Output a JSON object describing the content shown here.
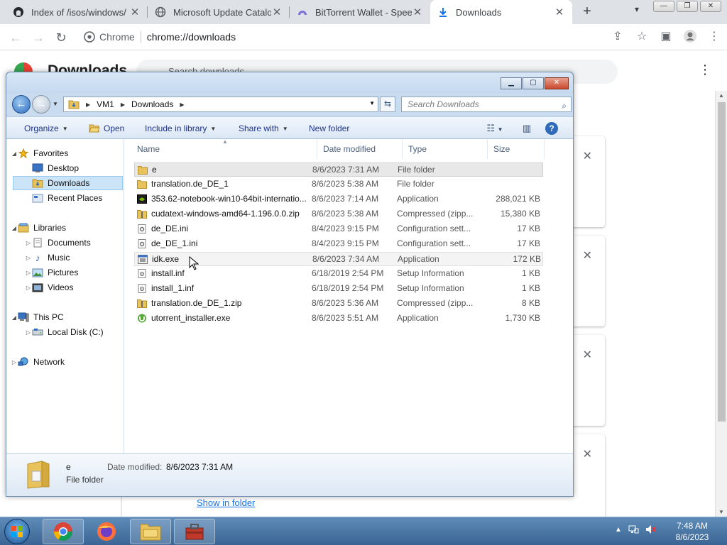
{
  "browser": {
    "tabs": [
      {
        "title": "Index of /isos/windows/",
        "icon": "github-icon"
      },
      {
        "title": "Microsoft Update Catalog",
        "icon": "globe-icon"
      },
      {
        "title": "BitTorrent Wallet - Speed",
        "icon": "bittorrent-icon"
      },
      {
        "title": "Downloads",
        "icon": "download-icon"
      }
    ],
    "omnibox": {
      "chip": "Chrome",
      "url": "chrome://downloads"
    },
    "page": {
      "title": "Downloads",
      "search_placeholder": "Search downloads",
      "show_in_folder": "Show in folder"
    }
  },
  "explorer": {
    "breadcrumb": [
      "VM1",
      "Downloads"
    ],
    "search_placeholder": "Search Downloads",
    "commands": {
      "organize": "Organize",
      "open": "Open",
      "include": "Include in library",
      "share": "Share with",
      "newfolder": "New folder"
    },
    "nav": {
      "favorites": "Favorites",
      "desktop": "Desktop",
      "downloads": "Downloads",
      "recent": "Recent Places",
      "libraries": "Libraries",
      "documents": "Documents",
      "music": "Music",
      "pictures": "Pictures",
      "videos": "Videos",
      "thispc": "This PC",
      "localdisk": "Local Disk (C:)",
      "network": "Network"
    },
    "columns": {
      "name": "Name",
      "date": "Date modified",
      "type": "Type",
      "size": "Size"
    },
    "files": [
      {
        "name": "e",
        "date": "8/6/2023 7:31 AM",
        "type": "File folder",
        "size": "",
        "icon": "folder-icon"
      },
      {
        "name": "translation.de_DE_1",
        "date": "8/6/2023 5:38 AM",
        "type": "File folder",
        "size": "",
        "icon": "folder-icon"
      },
      {
        "name": "353.62-notebook-win10-64bit-internatio...",
        "date": "8/6/2023 7:14 AM",
        "type": "Application",
        "size": "288,021 KB",
        "icon": "nvidia-icon"
      },
      {
        "name": "cudatext-windows-amd64-1.196.0.0.zip",
        "date": "8/6/2023 5:38 AM",
        "type": "Compressed (zipp...",
        "size": "15,380 KB",
        "icon": "zip-folder-icon"
      },
      {
        "name": "de_DE.ini",
        "date": "8/4/2023 9:15 PM",
        "type": "Configuration sett...",
        "size": "17 KB",
        "icon": "config-file-icon"
      },
      {
        "name": "de_DE_1.ini",
        "date": "8/4/2023 9:15 PM",
        "type": "Configuration sett...",
        "size": "17 KB",
        "icon": "config-file-icon"
      },
      {
        "name": "idk.exe",
        "date": "8/6/2023 7:34 AM",
        "type": "Application",
        "size": "172 KB",
        "icon": "exe-icon"
      },
      {
        "name": "install.inf",
        "date": "6/18/2019 2:54 PM",
        "type": "Setup Information",
        "size": "1 KB",
        "icon": "setup-file-icon"
      },
      {
        "name": "install_1.inf",
        "date": "6/18/2019 2:54 PM",
        "type": "Setup Information",
        "size": "1 KB",
        "icon": "setup-file-icon"
      },
      {
        "name": "translation.de_DE_1.zip",
        "date": "8/6/2023 5:36 AM",
        "type": "Compressed (zipp...",
        "size": "8 KB",
        "icon": "zip-folder-icon"
      },
      {
        "name": "utorrent_installer.exe",
        "date": "8/6/2023 5:51 AM",
        "type": "Application",
        "size": "1,730 KB",
        "icon": "utorrent-icon"
      }
    ],
    "details": {
      "name": "e",
      "type": "File folder",
      "date_label": "Date modified:",
      "date_value": "8/6/2023 7:31 AM"
    }
  },
  "taskbar": {
    "time": "7:48 AM",
    "date": "8/6/2023"
  }
}
